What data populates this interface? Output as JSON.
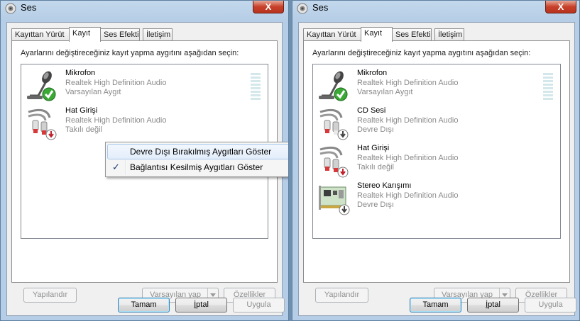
{
  "window1": {
    "title": "Ses",
    "close_label": "X",
    "tabs": [
      "Kayıttan Yürüt",
      "Kayıt",
      "Ses Efekti",
      "İletişim"
    ],
    "active_tab": "Kayıt",
    "instruction": "Ayarlarını değiştireceğiniz kayıt yapma aygıtını aşağıdan seçin:",
    "devices": [
      {
        "name": "Mikrofon",
        "driver": "Realtek High Definition Audio",
        "status": "Varsayılan Aygıt",
        "icon": "microphone-icon",
        "badge": "check-badge-icon"
      },
      {
        "name": "Hat Girişi",
        "driver": "Realtek High Definition Audio",
        "status": "Takılı değil",
        "icon": "line-in-cable-icon",
        "badge": "unplugged-badge-icon"
      }
    ],
    "context_menu": {
      "items": [
        {
          "label": "Devre Dışı Bırakılmış Aygıtları Göster",
          "checked": false,
          "hover": true
        },
        {
          "label": "Bağlantısı Kesilmiş Aygıtları Göster",
          "checked": true,
          "hover": false
        }
      ],
      "check_glyph": "✓"
    },
    "buttons": {
      "configure": "Yapılandır",
      "set_default": "Varsayılan yap",
      "properties": "Özellikler",
      "ok": "Tamam",
      "cancel_pre": "",
      "cancel_u": "İ",
      "cancel_post": "ptal",
      "apply": "Uygula"
    }
  },
  "window2": {
    "title": "Ses",
    "close_label": "X",
    "tabs": [
      "Kayıttan Yürüt",
      "Kayıt",
      "Ses Efekti",
      "İletişim"
    ],
    "active_tab": "Kayıt",
    "instruction": "Ayarlarını değiştireceğiniz kayıt yapma aygıtını aşağıdan seçin:",
    "devices": [
      {
        "name": "Mikrofon",
        "driver": "Realtek High Definition Audio",
        "status": "Varsayılan Aygıt",
        "icon": "microphone-icon",
        "badge": "check-badge-icon"
      },
      {
        "name": "CD Sesi",
        "driver": "Realtek High Definition Audio",
        "status": "Devre Dışı",
        "icon": "cd-audio-cable-icon",
        "badge": "disabled-badge-icon"
      },
      {
        "name": "Hat Girişi",
        "driver": "Realtek High Definition Audio",
        "status": "Takılı değil",
        "icon": "line-in-cable-icon",
        "badge": "unplugged-badge-icon"
      },
      {
        "name": "Stereo Karışımı",
        "driver": "Realtek High Definition Audio",
        "status": "Devre Dışı",
        "icon": "sound-card-icon",
        "badge": "disabled-badge-icon"
      }
    ],
    "buttons": {
      "configure": "Yapılandır",
      "set_default": "Varsayılan yap",
      "properties": "Özellikler",
      "ok": "Tamam",
      "cancel_pre": "",
      "cancel_u": "İ",
      "cancel_post": "ptal",
      "apply": "Uygula"
    }
  },
  "colors": {
    "window_frame": "#b5cde6",
    "close_button": "#c7412a",
    "default_badge": "#3aa936",
    "disconnected_badge": "#c0202a",
    "disabled_badge": "#5a5a5a"
  }
}
